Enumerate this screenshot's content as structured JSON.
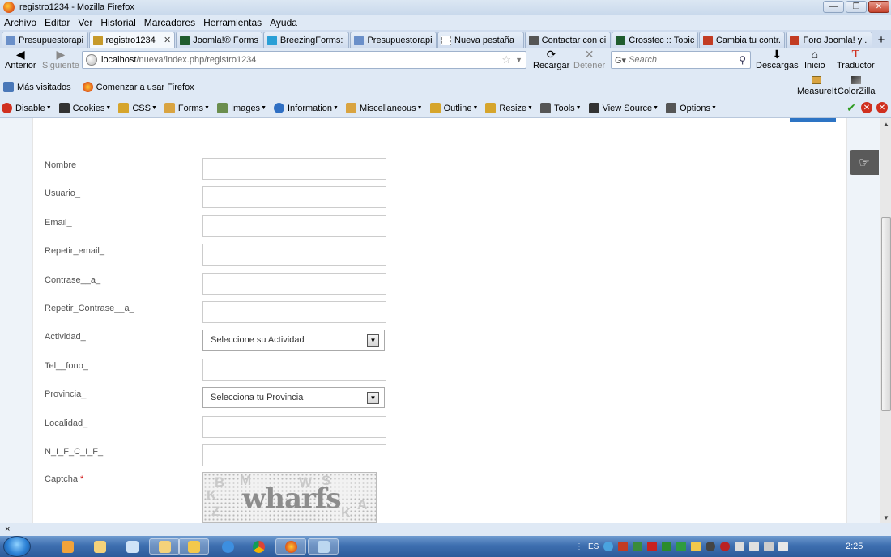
{
  "window": {
    "title": "registro1234 - Mozilla Firefox"
  },
  "menu": [
    "Archivo",
    "Editar",
    "Ver",
    "Historial",
    "Marcadores",
    "Herramientas",
    "Ayuda"
  ],
  "tabs": [
    {
      "label": "Presupuestorapi...",
      "icon": "puzzle-icon",
      "color": "#6a8fc9",
      "active": false
    },
    {
      "label": "registro1234",
      "icon": "page-icon",
      "color": "#c79a2b",
      "active": true
    },
    {
      "label": "Joomla!® Forms...",
      "icon": "crosstec-icon",
      "color": "#1f5c2e",
      "active": false
    },
    {
      "label": "BreezingForms: ...",
      "icon": "vimeo-icon",
      "color": "#2a9fd6",
      "active": false
    },
    {
      "label": "Presupuestorapi...",
      "icon": "puzzle-icon",
      "color": "#6a8fc9",
      "active": false
    },
    {
      "label": "Nueva pestaña",
      "icon": "blank-page-icon",
      "color": "#ffffff",
      "active": false
    },
    {
      "label": "Contactar con ci...",
      "icon": "google-icon",
      "color": "#555555",
      "active": false
    },
    {
      "label": "Crosstec :: Topic...",
      "icon": "crosstec-icon",
      "color": "#1f5c2e",
      "active": false
    },
    {
      "label": "Cambia tu contr...",
      "icon": "joomla-forum-icon",
      "color": "#c23b22",
      "active": false
    },
    {
      "label": "Foro Joomla! y ...",
      "icon": "joomla-forum-icon",
      "color": "#c23b22",
      "active": false
    }
  ],
  "nav": {
    "back": "Anterior",
    "forward": "Siguiente",
    "url_host": "localhost",
    "url_path": "/nueva/index.php/registro1234",
    "reload": "Recargar",
    "stop": "Detener",
    "search_placeholder": "Search",
    "downloads": "Descargas",
    "home": "Inicio",
    "translator": "Traductor"
  },
  "bookmarks": {
    "most_visited": "Más visitados",
    "getting_started": "Comenzar a usar Firefox",
    "measureit": "MeasureIt",
    "colorzilla": "ColorZilla"
  },
  "devbar": [
    {
      "label": "Disable",
      "icon": "disable-icon",
      "color": "#d0301f"
    },
    {
      "label": "Cookies",
      "icon": "cookie-icon",
      "color": "#333333"
    },
    {
      "label": "CSS",
      "icon": "pencil-icon",
      "color": "#d6a52c"
    },
    {
      "label": "Forms",
      "icon": "forms-icon",
      "color": "#d9a441"
    },
    {
      "label": "Images",
      "icon": "image-icon",
      "color": "#6b8e4e"
    },
    {
      "label": "Information",
      "icon": "info-icon",
      "color": "#2f6fc3"
    },
    {
      "label": "Miscellaneous",
      "icon": "misc-icon",
      "color": "#d9a441"
    },
    {
      "label": "Outline",
      "icon": "outline-pencil-icon",
      "color": "#d6a52c"
    },
    {
      "label": "Resize",
      "icon": "resize-icon",
      "color": "#d6a52c"
    },
    {
      "label": "Tools",
      "icon": "tools-icon",
      "color": "#555555"
    },
    {
      "label": "View Source",
      "icon": "source-icon",
      "color": "#333333"
    },
    {
      "label": "Options",
      "icon": "options-icon",
      "color": "#555555"
    }
  ],
  "form": {
    "fields": [
      {
        "label": "Nombre",
        "type": "text"
      },
      {
        "label": "Usuario_",
        "type": "text"
      },
      {
        "label": "Email_",
        "type": "text"
      },
      {
        "label": "Repetir_email_",
        "type": "text"
      },
      {
        "label": "Contrase__a_",
        "type": "text"
      },
      {
        "label": "Repetir_Contrase__a_",
        "type": "text"
      },
      {
        "label": "Actividad_",
        "type": "select",
        "value": "Seleccione su Actividad"
      },
      {
        "label": "Tel__fono_",
        "type": "text"
      },
      {
        "label": "Provincia_",
        "type": "select",
        "value": "Selecciona tu Provincia"
      },
      {
        "label": "Localidad_",
        "type": "text"
      },
      {
        "label": "N_I_F_C_I_F_",
        "type": "text"
      }
    ],
    "captcha_label": "Captcha",
    "captcha_required": "*",
    "captcha_word": "wharfs"
  },
  "statusbar": {
    "close": "×"
  },
  "taskbar": {
    "language": "ES",
    "time": "2:25"
  }
}
